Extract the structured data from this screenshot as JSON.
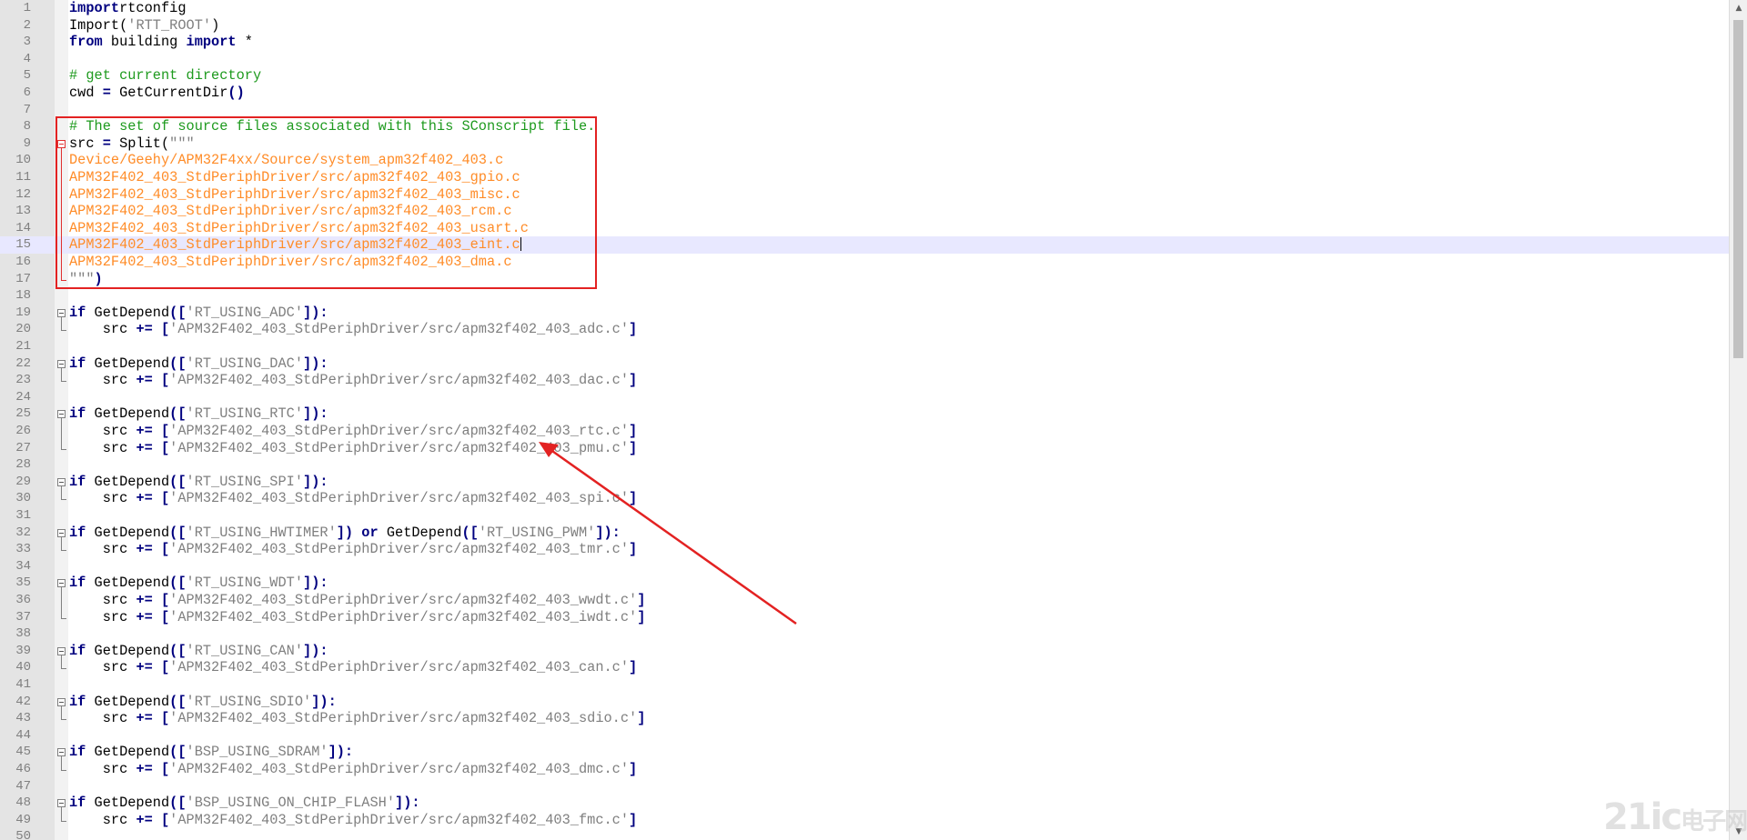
{
  "editor": {
    "lines": [
      {
        "n": "1",
        "tokens": [
          [
            "kw",
            "import"
          ],
          [
            "",
            "rtconfig"
          ]
        ]
      },
      {
        "n": "2",
        "tokens": [
          [
            "",
            "Import("
          ],
          [
            "str",
            "'RTT_ROOT'"
          ],
          [
            "",
            ")"
          ]
        ]
      },
      {
        "n": "3",
        "tokens": [
          [
            "kw",
            "from"
          ],
          [
            "",
            " building "
          ],
          [
            "kw",
            "import"
          ],
          [
            "",
            " *"
          ]
        ]
      },
      {
        "n": "4",
        "tokens": []
      },
      {
        "n": "5",
        "tokens": [
          [
            "cmt",
            "# get current directory"
          ]
        ]
      },
      {
        "n": "6",
        "tokens": [
          [
            "",
            "cwd "
          ],
          [
            "op",
            "="
          ],
          [
            "",
            " GetCurrentDir"
          ],
          [
            "op",
            "()"
          ]
        ]
      },
      {
        "n": "7",
        "tokens": []
      },
      {
        "n": "8",
        "tokens": [
          [
            "cmt",
            "# The set of source files associated with this SConscript file."
          ]
        ]
      },
      {
        "n": "9",
        "tokens": [
          [
            "",
            "src "
          ],
          [
            "op",
            "="
          ],
          [
            "",
            " Split("
          ],
          [
            "str",
            "\"\"\""
          ]
        ]
      },
      {
        "n": "10",
        "tokens": [
          [
            "path",
            "Device/Geehy/APM32F4xx/Source/system_apm32f402_403.c"
          ]
        ]
      },
      {
        "n": "11",
        "tokens": [
          [
            "path",
            "APM32F402_403_StdPeriphDriver/src/apm32f402_403_gpio.c"
          ]
        ]
      },
      {
        "n": "12",
        "tokens": [
          [
            "path",
            "APM32F402_403_StdPeriphDriver/src/apm32f402_403_misc.c"
          ]
        ]
      },
      {
        "n": "13",
        "tokens": [
          [
            "path",
            "APM32F402_403_StdPeriphDriver/src/apm32f402_403_rcm.c"
          ]
        ]
      },
      {
        "n": "14",
        "tokens": [
          [
            "path",
            "APM32F402_403_StdPeriphDriver/src/apm32f402_403_usart.c"
          ]
        ]
      },
      {
        "n": "15",
        "tokens": [
          [
            "path",
            "APM32F402_403_StdPeriphDriver/src/apm32f402_403_eint.c"
          ]
        ]
      },
      {
        "n": "16",
        "tokens": [
          [
            "path",
            "APM32F402_403_StdPeriphDriver/src/apm32f402_403_dma.c"
          ]
        ]
      },
      {
        "n": "17",
        "tokens": [
          [
            "str",
            "\"\"\""
          ],
          [
            "op",
            ")"
          ]
        ]
      },
      {
        "n": "18",
        "tokens": []
      },
      {
        "n": "19",
        "tokens": [
          [
            "kw",
            "if"
          ],
          [
            "",
            " GetDepend"
          ],
          [
            "op",
            "(["
          ],
          [
            "str",
            "'RT_USING_ADC'"
          ],
          [
            "op",
            "]):"
          ]
        ]
      },
      {
        "n": "20",
        "tokens": [
          [
            "",
            "    src "
          ],
          [
            "op",
            "+="
          ],
          [
            "",
            ""
          ],
          [
            "op",
            " ["
          ],
          [
            "str",
            "'APM32F402_403_StdPeriphDriver/src/apm32f402_403_adc.c'"
          ],
          [
            "op",
            "]"
          ]
        ]
      },
      {
        "n": "21",
        "tokens": []
      },
      {
        "n": "22",
        "tokens": [
          [
            "kw",
            "if"
          ],
          [
            "",
            " GetDepend"
          ],
          [
            "op",
            "(["
          ],
          [
            "str",
            "'RT_USING_DAC'"
          ],
          [
            "op",
            "]):"
          ]
        ]
      },
      {
        "n": "23",
        "tokens": [
          [
            "",
            "    src "
          ],
          [
            "op",
            "+="
          ],
          [
            "op",
            " ["
          ],
          [
            "str",
            "'APM32F402_403_StdPeriphDriver/src/apm32f402_403_dac.c'"
          ],
          [
            "op",
            "]"
          ]
        ]
      },
      {
        "n": "24",
        "tokens": []
      },
      {
        "n": "25",
        "tokens": [
          [
            "kw",
            "if"
          ],
          [
            "",
            " GetDepend"
          ],
          [
            "op",
            "(["
          ],
          [
            "str",
            "'RT_USING_RTC'"
          ],
          [
            "op",
            "]):"
          ]
        ]
      },
      {
        "n": "26",
        "tokens": [
          [
            "",
            "    src "
          ],
          [
            "op",
            "+="
          ],
          [
            "op",
            " ["
          ],
          [
            "str",
            "'APM32F402_403_StdPeriphDriver/src/apm32f402_403_rtc.c'"
          ],
          [
            "op",
            "]"
          ]
        ]
      },
      {
        "n": "27",
        "tokens": [
          [
            "",
            "    src "
          ],
          [
            "op",
            "+="
          ],
          [
            "op",
            " ["
          ],
          [
            "str",
            "'APM32F402_403_StdPeriphDriver/src/apm32f402_403_pmu.c'"
          ],
          [
            "op",
            "]"
          ]
        ]
      },
      {
        "n": "28",
        "tokens": []
      },
      {
        "n": "29",
        "tokens": [
          [
            "kw",
            "if"
          ],
          [
            "",
            " GetDepend"
          ],
          [
            "op",
            "(["
          ],
          [
            "str",
            "'RT_USING_SPI'"
          ],
          [
            "op",
            "]):"
          ]
        ]
      },
      {
        "n": "30",
        "tokens": [
          [
            "",
            "    src "
          ],
          [
            "op",
            "+="
          ],
          [
            "op",
            " ["
          ],
          [
            "str",
            "'APM32F402_403_StdPeriphDriver/src/apm32f402_403_spi.c'"
          ],
          [
            "op",
            "]"
          ]
        ]
      },
      {
        "n": "31",
        "tokens": []
      },
      {
        "n": "32",
        "tokens": [
          [
            "kw",
            "if"
          ],
          [
            "",
            " GetDepend"
          ],
          [
            "op",
            "(["
          ],
          [
            "str",
            "'RT_USING_HWTIMER'"
          ],
          [
            "op",
            "])"
          ],
          [
            "",
            " "
          ],
          [
            "kw",
            "or"
          ],
          [
            "",
            " GetDepend"
          ],
          [
            "op",
            "(["
          ],
          [
            "str",
            "'RT_USING_PWM'"
          ],
          [
            "op",
            "]):"
          ]
        ]
      },
      {
        "n": "33",
        "tokens": [
          [
            "",
            "    src "
          ],
          [
            "op",
            "+="
          ],
          [
            "op",
            " ["
          ],
          [
            "str",
            "'APM32F402_403_StdPeriphDriver/src/apm32f402_403_tmr.c'"
          ],
          [
            "op",
            "]"
          ]
        ]
      },
      {
        "n": "34",
        "tokens": []
      },
      {
        "n": "35",
        "tokens": [
          [
            "kw",
            "if"
          ],
          [
            "",
            " GetDepend"
          ],
          [
            "op",
            "(["
          ],
          [
            "str",
            "'RT_USING_WDT'"
          ],
          [
            "op",
            "]):"
          ]
        ]
      },
      {
        "n": "36",
        "tokens": [
          [
            "",
            "    src "
          ],
          [
            "op",
            "+="
          ],
          [
            "op",
            " ["
          ],
          [
            "str",
            "'APM32F402_403_StdPeriphDriver/src/apm32f402_403_wwdt.c'"
          ],
          [
            "op",
            "]"
          ]
        ]
      },
      {
        "n": "37",
        "tokens": [
          [
            "",
            "    src "
          ],
          [
            "op",
            "+="
          ],
          [
            "op",
            " ["
          ],
          [
            "str",
            "'APM32F402_403_StdPeriphDriver/src/apm32f402_403_iwdt.c'"
          ],
          [
            "op",
            "]"
          ]
        ]
      },
      {
        "n": "38",
        "tokens": []
      },
      {
        "n": "39",
        "tokens": [
          [
            "kw",
            "if"
          ],
          [
            "",
            " GetDepend"
          ],
          [
            "op",
            "(["
          ],
          [
            "str",
            "'RT_USING_CAN'"
          ],
          [
            "op",
            "]):"
          ]
        ]
      },
      {
        "n": "40",
        "tokens": [
          [
            "",
            "    src "
          ],
          [
            "op",
            "+="
          ],
          [
            "op",
            " ["
          ],
          [
            "str",
            "'APM32F402_403_StdPeriphDriver/src/apm32f402_403_can.c'"
          ],
          [
            "op",
            "]"
          ]
        ]
      },
      {
        "n": "41",
        "tokens": []
      },
      {
        "n": "42",
        "tokens": [
          [
            "kw",
            "if"
          ],
          [
            "",
            " GetDepend"
          ],
          [
            "op",
            "(["
          ],
          [
            "str",
            "'RT_USING_SDIO'"
          ],
          [
            "op",
            "]):"
          ]
        ]
      },
      {
        "n": "43",
        "tokens": [
          [
            "",
            "    src "
          ],
          [
            "op",
            "+="
          ],
          [
            "op",
            " ["
          ],
          [
            "str",
            "'APM32F402_403_StdPeriphDriver/src/apm32f402_403_sdio.c'"
          ],
          [
            "op",
            "]"
          ]
        ]
      },
      {
        "n": "44",
        "tokens": []
      },
      {
        "n": "45",
        "tokens": [
          [
            "kw",
            "if"
          ],
          [
            "",
            " GetDepend"
          ],
          [
            "op",
            "(["
          ],
          [
            "str",
            "'BSP_USING_SDRAM'"
          ],
          [
            "op",
            "]):"
          ]
        ]
      },
      {
        "n": "46",
        "tokens": [
          [
            "",
            "    src "
          ],
          [
            "op",
            "+="
          ],
          [
            "op",
            " ["
          ],
          [
            "str",
            "'APM32F402_403_StdPeriphDriver/src/apm32f402_403_dmc.c'"
          ],
          [
            "op",
            "]"
          ]
        ]
      },
      {
        "n": "47",
        "tokens": []
      },
      {
        "n": "48",
        "tokens": [
          [
            "kw",
            "if"
          ],
          [
            "",
            " GetDepend"
          ],
          [
            "op",
            "(["
          ],
          [
            "str",
            "'BSP_USING_ON_CHIP_FLASH'"
          ],
          [
            "op",
            "]):"
          ]
        ]
      },
      {
        "n": "49",
        "tokens": [
          [
            "",
            "    src "
          ],
          [
            "op",
            "+="
          ],
          [
            "op",
            " ["
          ],
          [
            "str",
            "'APM32F402_403_StdPeriphDriver/src/apm32f402_403_fmc.c'"
          ],
          [
            "op",
            "]"
          ]
        ]
      },
      {
        "n": "50",
        "tokens": []
      }
    ],
    "current_line": "15",
    "fold_markers": [
      "9",
      "19",
      "22",
      "25",
      "29",
      "32",
      "35",
      "39",
      "42",
      "45",
      "48"
    ]
  },
  "watermark": {
    "logo_text": "21ic",
    "logo_cn": "电子网"
  },
  "colors": {
    "keyword": "#00007f",
    "string": "#7f7f7f",
    "path_text": "#ff8c28",
    "comment": "#1e9a1e",
    "highlight_box": "#e32222",
    "arrow": "#e32222"
  }
}
